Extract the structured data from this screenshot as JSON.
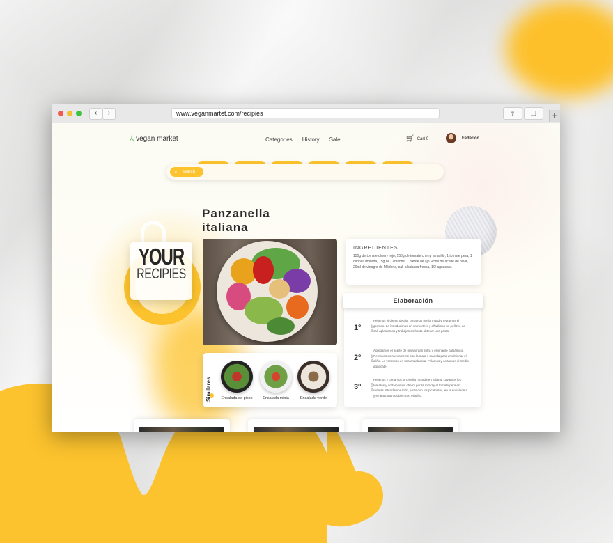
{
  "browser": {
    "url": "www.veganmartet.com/recipies",
    "back_icon": "chevron-left-icon",
    "forward_icon": "chevron-right-icon",
    "share_icon": "share-icon",
    "tabs_icon": "tabs-icon",
    "new_tab_icon": "plus-icon"
  },
  "header": {
    "brand": "vegan market",
    "menu": [
      "Categories",
      "History",
      "Sale"
    ],
    "cart_label": "Cart 0",
    "user_name": "Federico"
  },
  "search": {
    "placeholder": "search"
  },
  "recipe": {
    "title_line1": "Panzanella",
    "title_line2": "italiana",
    "badge_line1": "YOUR",
    "badge_line2": "RECIPIES"
  },
  "ingredients": {
    "title": "INGREDIENTES",
    "text": "150g de tomate cherry rojo, 150g de tomate cherry amarillo, 1 tomate pera, 1 cebolla morada, 75g de Croutons, 1 diente de ajo, 45ml de aceite de oliva, 20ml de vinagre de Módena, sal, albahaca fresca, 1/2 aguacate."
  },
  "elaboracion": {
    "title": "Elaboración",
    "steps": [
      {
        "num": "1º",
        "paso": "PASO",
        "text": "Pelamos el diente de ajo, cortamos por la mitad y retiramos el germen. Lo introducimos en un mortero y añadimos un pellizco de sal, aplastamos y trabajamos hasta obtener una pasta."
      },
      {
        "num": "2º",
        "paso": "PASO",
        "text": "Agregamos el aceite de oliva virgen extra y el vinagre balsámico. Removemos nuevamente con la maja o manela para emulsionar el aliño. Lo vertemos en una ensaladera. Pelamos y cortamos el medio aguacate."
      },
      {
        "num": "3º",
        "paso": "PASO",
        "text": "Pelamos y cortamos la cebolla morada en juliana. Lavamos los tomates y cortamos los cherry por la mitad y el tomate pera en rodajas. Mezclamos todo, junto con los picatostes, en la ensaladera y embadurnamos bien con el aliño."
      }
    ]
  },
  "similares": {
    "title": "Similares",
    "items": [
      {
        "caption": "Ensalada de picos"
      },
      {
        "caption": "Ensalada mixta"
      },
      {
        "caption": "Ensalada verde"
      }
    ]
  },
  "colors": {
    "accent": "#fcc32e",
    "text_dark": "#2a2a2a"
  }
}
